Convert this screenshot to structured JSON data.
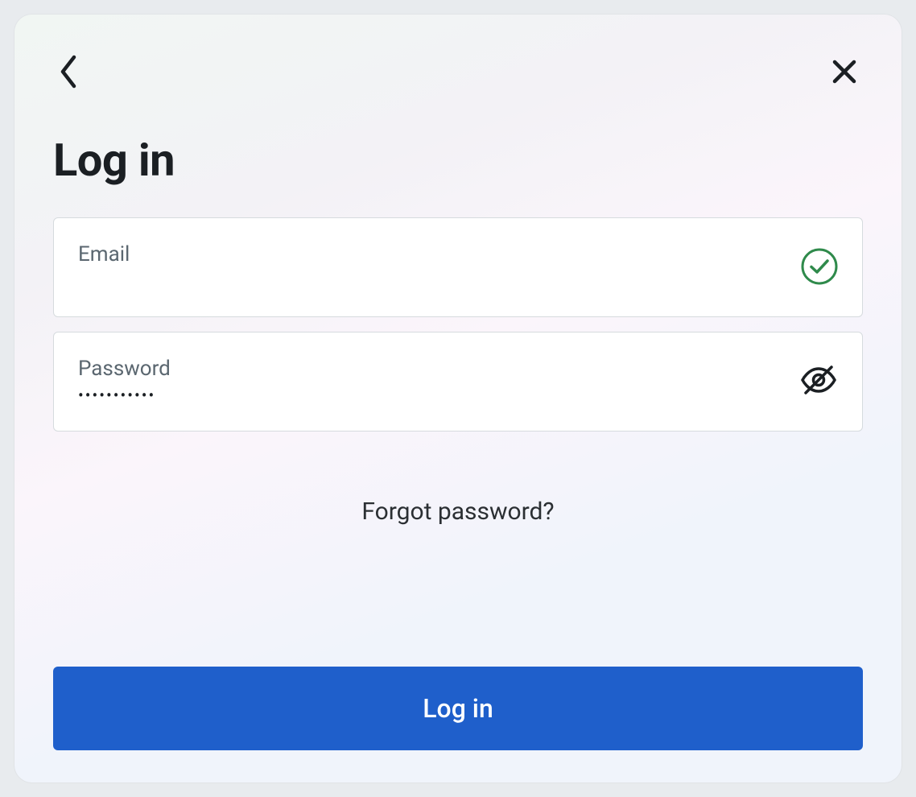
{
  "title": "Log in",
  "email": {
    "label": "Email",
    "value": "",
    "valid": true
  },
  "password": {
    "label": "Password",
    "value": "•••••••••••",
    "visible": false
  },
  "forgot_link": "Forgot password?",
  "submit_label": "Log in",
  "colors": {
    "primary": "#1f5fcb",
    "success": "#2f8a4b",
    "text": "#1b1f23",
    "muted": "#5b6770",
    "border": "#d6dbde"
  }
}
